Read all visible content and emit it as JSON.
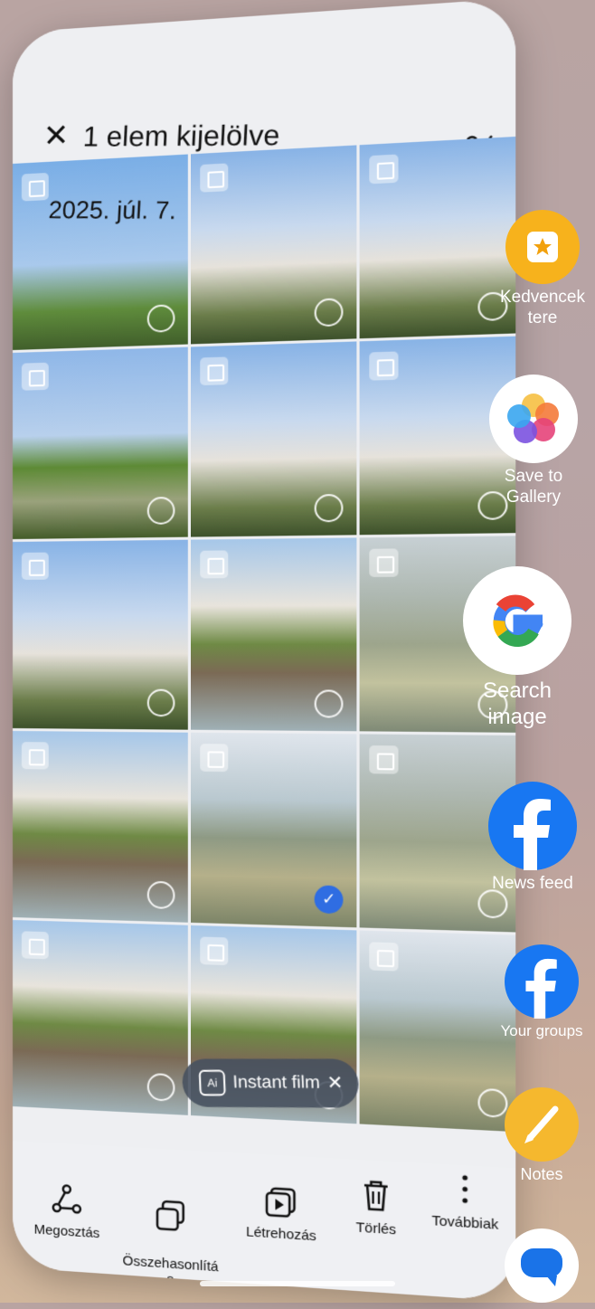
{
  "selection": {
    "title": "1 elem kijelölve",
    "date": "2025. júl. 7."
  },
  "grid": {
    "tiles": [
      {
        "scene": "sky",
        "selected": false
      },
      {
        "scene": "build",
        "selected": false
      },
      {
        "scene": "build",
        "selected": false
      },
      {
        "scene": "park",
        "selected": false
      },
      {
        "scene": "build",
        "selected": false
      },
      {
        "scene": "build",
        "selected": false
      },
      {
        "scene": "build",
        "selected": false
      },
      {
        "scene": "plaza",
        "selected": false
      },
      {
        "scene": "water",
        "selected": false
      },
      {
        "scene": "plaza",
        "selected": false
      },
      {
        "scene": "pond",
        "selected": true
      },
      {
        "scene": "water",
        "selected": false
      },
      {
        "scene": "plaza",
        "selected": false
      },
      {
        "scene": "plaza",
        "selected": false
      },
      {
        "scene": "pond",
        "selected": false
      }
    ]
  },
  "film_pill": {
    "label": "Instant film",
    "ai_label": "Ai"
  },
  "bottom_actions": {
    "share": "Megosztás",
    "compare": "Összehasonlítá\ns",
    "create": "Létrehozás",
    "delete": "Törlés",
    "more": "Továbbiak"
  },
  "side_shortcuts": {
    "kedvencek": "Kedvencek tere",
    "save_gallery": "Save to Gallery",
    "search_image": "Search image",
    "news_feed": "News feed",
    "your_groups": "Your groups",
    "notes": "Notes"
  },
  "colors": {
    "accent": "#2f6de2",
    "facebook": "#1877f2",
    "notes": "#f5b82e",
    "kedvencek": "#f7b21c"
  }
}
